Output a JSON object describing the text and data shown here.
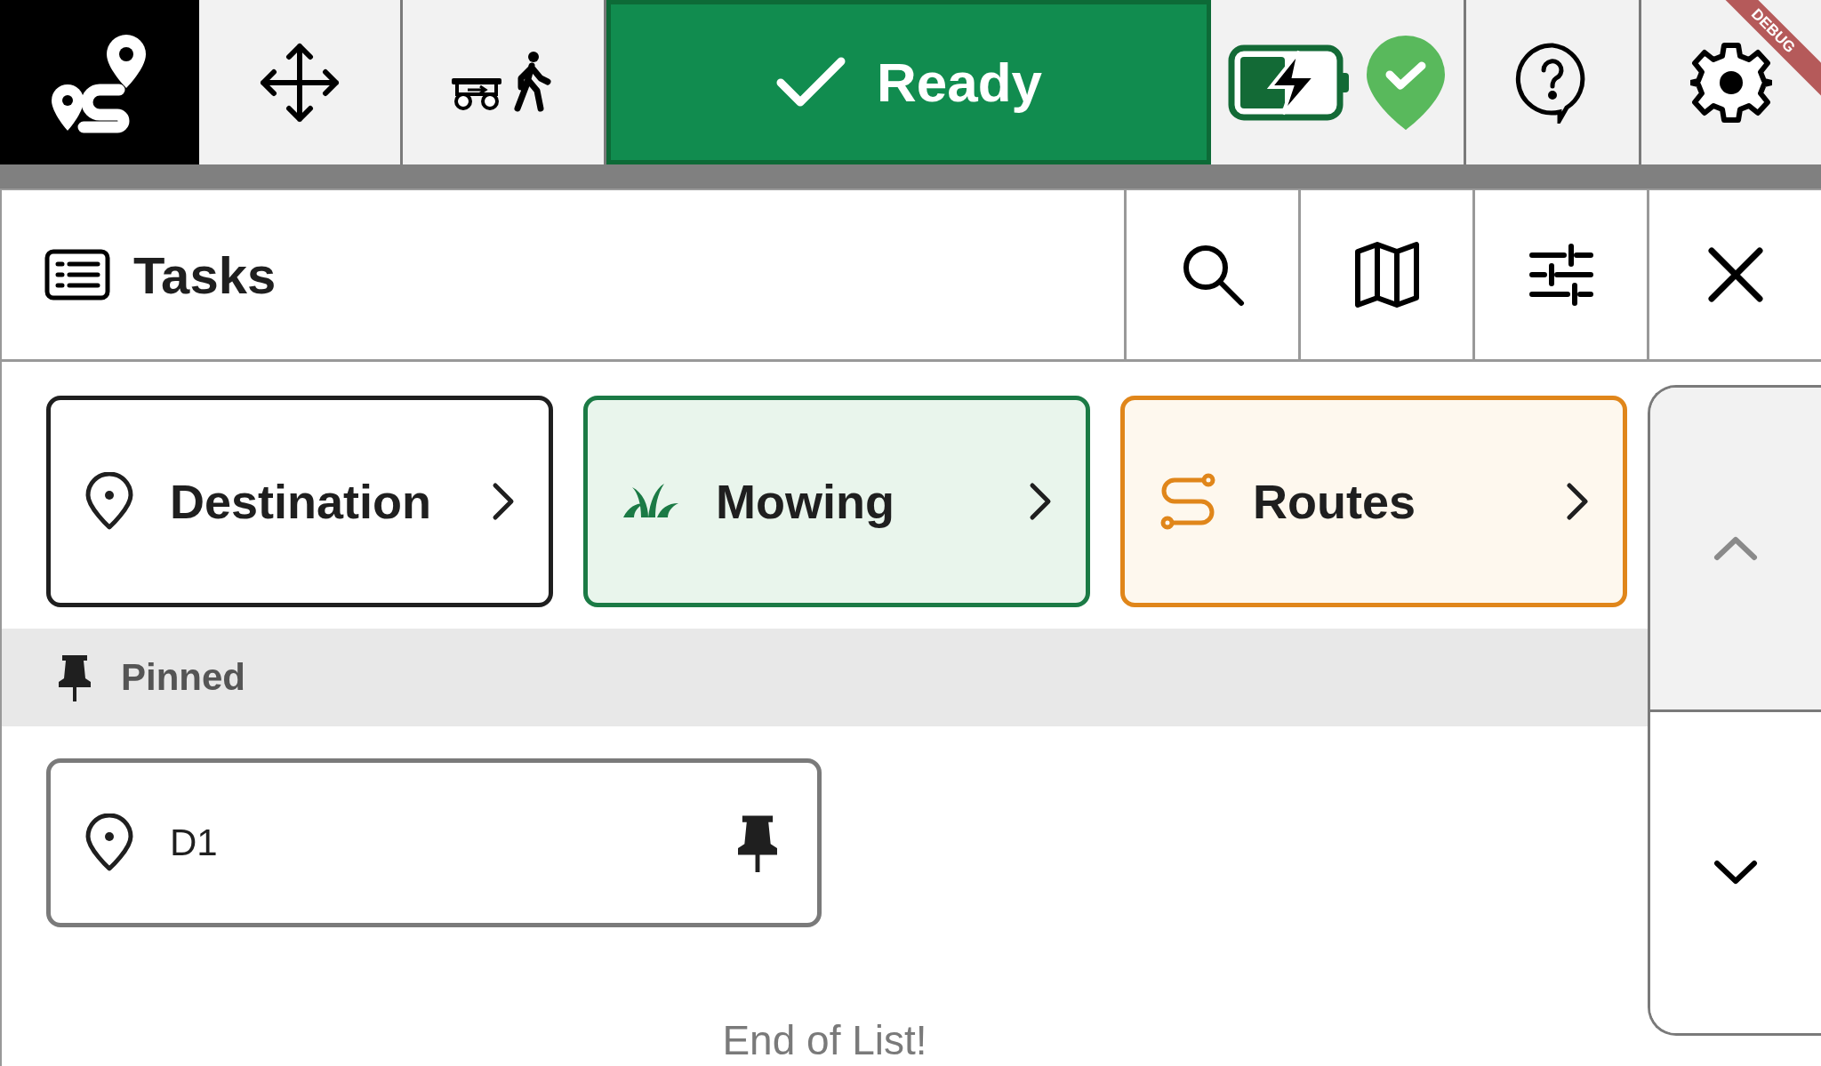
{
  "status": {
    "label": "Ready"
  },
  "debug_banner": "DEBUG",
  "panel": {
    "title": "Tasks"
  },
  "categories": [
    {
      "kind": "destination",
      "label": "Destination",
      "color": "#1f1f1f"
    },
    {
      "kind": "mowing",
      "label": "Mowing",
      "color": "#1b7a45"
    },
    {
      "kind": "routes",
      "label": "Routes",
      "color": "#e0861a"
    }
  ],
  "pinned_section": {
    "label": "Pinned"
  },
  "pinned": [
    {
      "kind": "destination",
      "label": "D1",
      "pinned": true
    }
  ],
  "end_text": "End of List!",
  "scroll": [
    {
      "kind": "up",
      "disabled": true
    },
    {
      "kind": "down",
      "disabled": false
    }
  ]
}
